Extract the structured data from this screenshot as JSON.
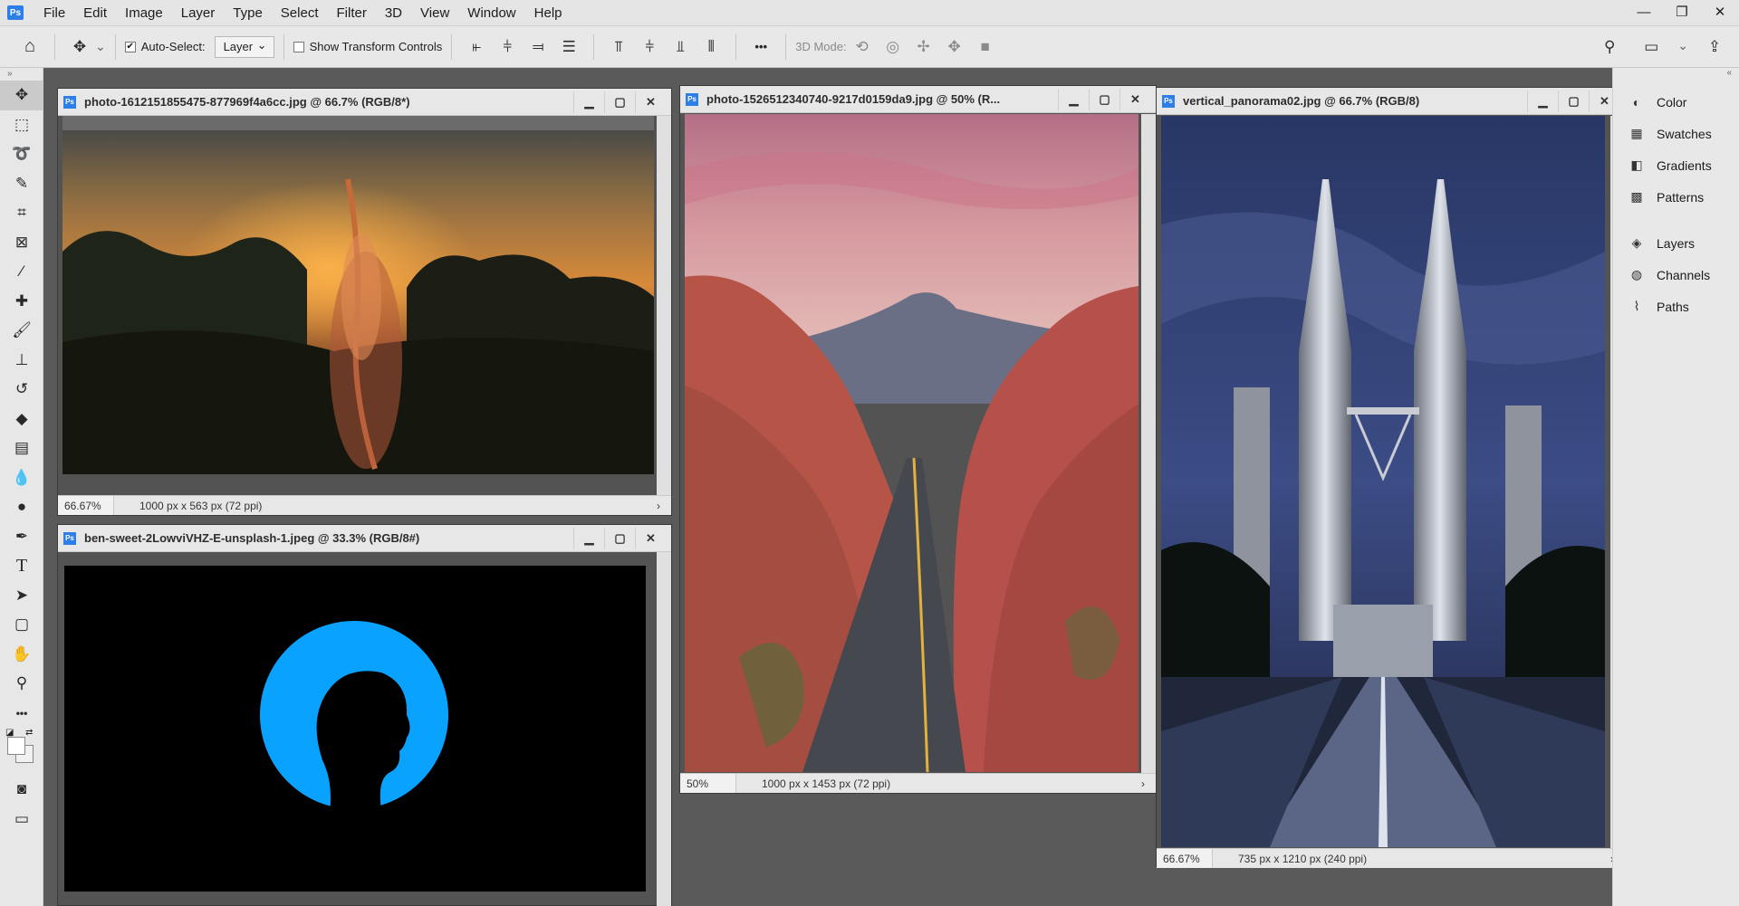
{
  "menubar": {
    "logo": "Ps",
    "items": [
      "File",
      "Edit",
      "Image",
      "Layer",
      "Type",
      "Select",
      "Filter",
      "3D",
      "View",
      "Window",
      "Help"
    ],
    "window_controls": [
      "—",
      "❐",
      "✕"
    ]
  },
  "options": {
    "auto_select_label": "Auto-Select:",
    "auto_select_checked": "✔",
    "layer_select": "Layer",
    "show_transform_label": "Show Transform Controls",
    "more": "•••",
    "mode_3d_label": "3D Mode:"
  },
  "panels": {
    "items": [
      {
        "label": "Color",
        "icon": "color-wheel-icon"
      },
      {
        "label": "Swatches",
        "icon": "swatches-grid-icon"
      },
      {
        "label": "Gradients",
        "icon": "gradient-icon"
      },
      {
        "label": "Patterns",
        "icon": "pattern-icon"
      },
      {
        "label": "Layers",
        "icon": "layers-icon"
      },
      {
        "label": "Channels",
        "icon": "channels-icon"
      },
      {
        "label": "Paths",
        "icon": "paths-icon"
      }
    ]
  },
  "documents": [
    {
      "title": "photo-1612151855475-877969f4a6cc.jpg @ 66.7% (RGB/8*)",
      "zoom": "66.67%",
      "dims": "1000 px x 563 px (72 ppi)"
    },
    {
      "title": "photo-1526512340740-9217d0159da9.jpg @ 50% (R...",
      "zoom": "50%",
      "dims": "1000 px x 1453 px (72 ppi)"
    },
    {
      "title": "vertical_panorama02.jpg @ 66.7% (RGB/8)",
      "zoom": "66.67%",
      "dims": "735 px x 1210 px (240 ppi)"
    },
    {
      "title": "ben-sweet-2LowviVHZ-E-unsplash-1.jpeg @ 33.3% (RGB/8#)",
      "zoom": "",
      "dims": ""
    }
  ],
  "doc_window_controls": [
    "▁",
    "▢",
    "✕"
  ],
  "status_arrow": "›",
  "colors": {
    "ui_bg": "#e8e8e8",
    "workspace": "#5a5a5a",
    "accent": "#2d7ee6",
    "circle_blue": "#0aa2ff"
  }
}
